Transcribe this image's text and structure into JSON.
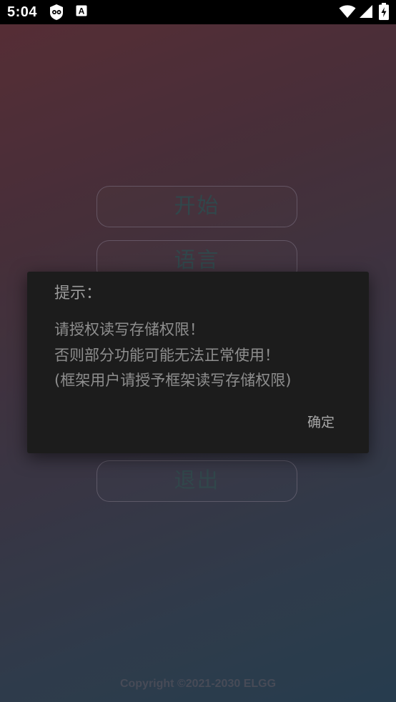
{
  "status_bar": {
    "time": "5:04",
    "icons": [
      "app-shield-icon",
      "text-a-icon",
      "wifi-icon",
      "cell-signal-icon",
      "battery-charging-icon"
    ],
    "notification_letter": "A"
  },
  "menu": {
    "start_label": "开始",
    "language_label": "语言",
    "exit_label": "退出"
  },
  "dialog": {
    "title": "提示：",
    "message_lines": [
      "请授权读写存储权限！",
      "否则部分功能可能无法正常使用！",
      "(框架用户请授予框架读写存储权限)"
    ],
    "ok_label": "确定"
  },
  "footer": {
    "copyright": "Copyright ©2021-2030 ELGG"
  },
  "colors": {
    "status_bar_bg": "#000000",
    "dialog_bg": "#1c1c1c",
    "menu_text": "#3f5b60",
    "gradient_top": "#6e3a45",
    "gradient_bottom": "#324e64"
  }
}
